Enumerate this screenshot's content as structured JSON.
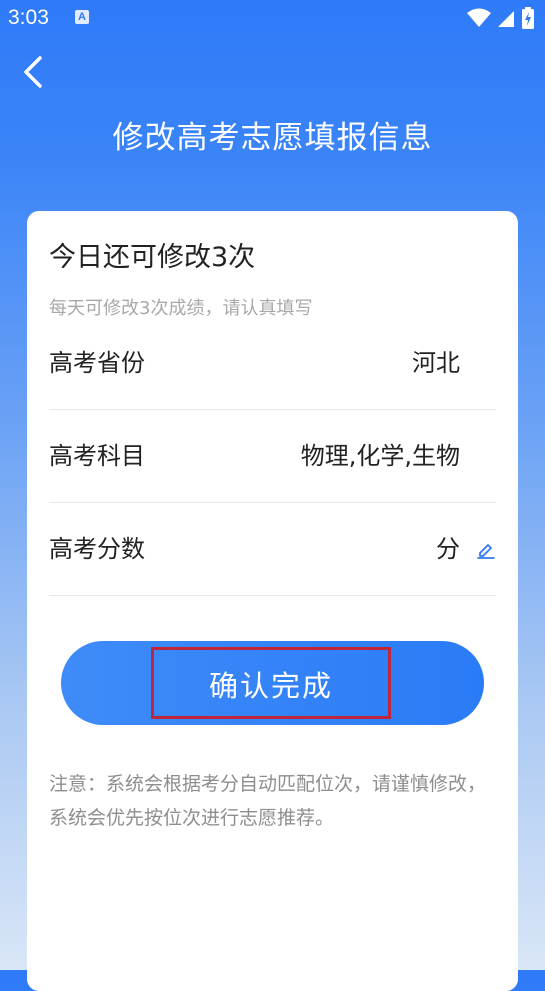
{
  "status_bar": {
    "time": "3:03",
    "notification_badge": "A"
  },
  "header": {
    "title": "修改高考志愿填报信息"
  },
  "card": {
    "heading": "今日还可修改3次",
    "subheading": "每天可修改3次成绩，请认真填写",
    "rows": [
      {
        "label": "高考省份",
        "value": "河北"
      },
      {
        "label": "高考科目",
        "value": "物理,化学,生物"
      },
      {
        "label": "高考分数",
        "value": "分"
      }
    ],
    "confirm_label": "确认完成",
    "notice": "注意：系统会根据考分自动匹配位次，请谨慎修改， 系统会优先按位次进行志愿推荐。"
  },
  "icons": {
    "back": "chevron-left-icon",
    "edit": "pencil-icon",
    "wifi": "wifi-icon",
    "signal": "signal-icon",
    "battery": "battery-icon"
  },
  "colors": {
    "primary": "#2f7af8",
    "button": "#3f8bf9",
    "highlight_border": "#c0263b"
  }
}
